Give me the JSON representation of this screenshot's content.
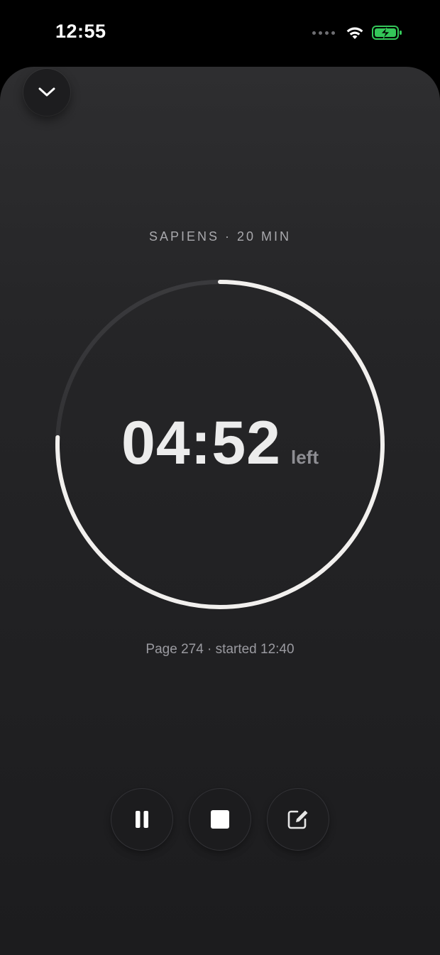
{
  "status_bar": {
    "time": "12:55",
    "signal_icon": "cellular-dots-icon",
    "wifi_icon": "wifi-icon",
    "battery_icon": "battery-charging-icon",
    "battery_color": "#34c759"
  },
  "header": {
    "collapse_icon": "chevron-down-icon"
  },
  "session": {
    "title": "SAPIENS · 20 MIN",
    "time_left": "04:52",
    "time_suffix": "left",
    "progress_fraction": 0.757,
    "info": "Page 274 · started 12:40"
  },
  "controls": {
    "pause_icon": "pause-icon",
    "stop_icon": "stop-icon",
    "edit_icon": "edit-note-icon"
  },
  "colors": {
    "background": "#1c1c1e",
    "ring_active": "#f2f0ee",
    "ring_track": "#2c2c2e",
    "text_muted": "#a9a9ad"
  }
}
